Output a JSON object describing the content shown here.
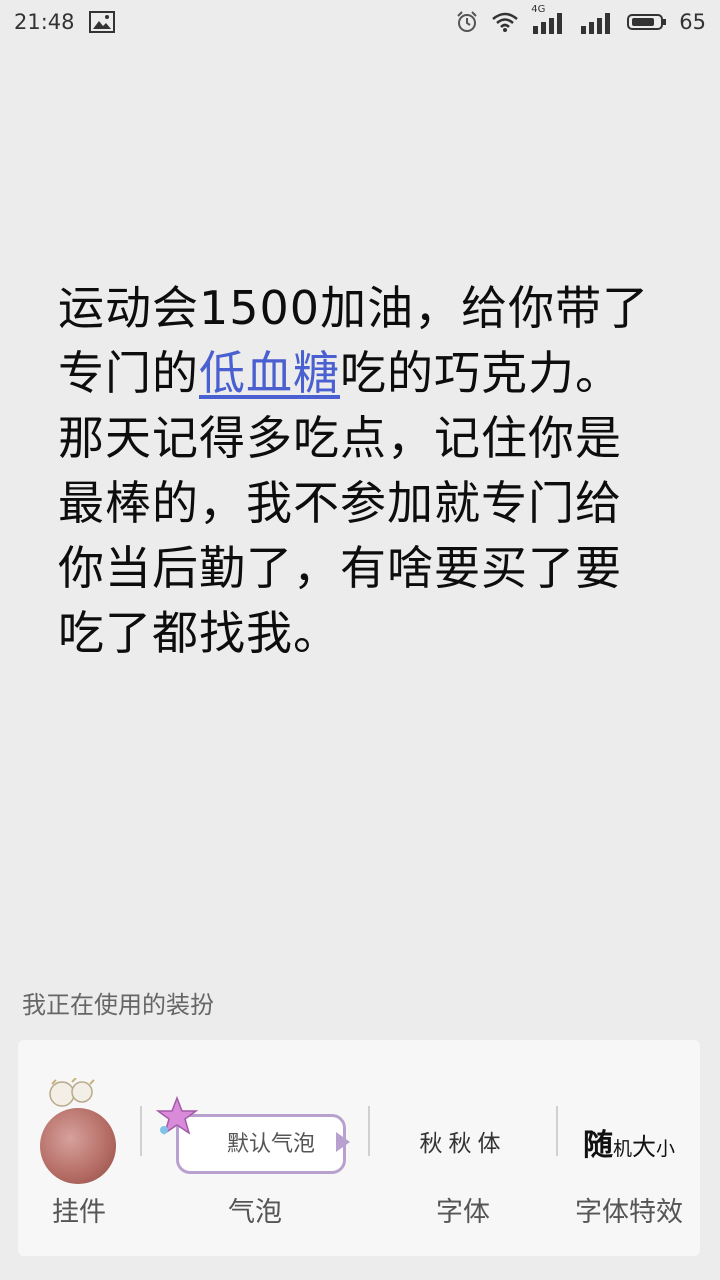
{
  "status_bar": {
    "time": "21:48",
    "network_type": "4G",
    "battery": "65",
    "icons": [
      "image-icon",
      "alarm-icon",
      "wifi-icon",
      "signal-icon",
      "battery-icon"
    ]
  },
  "message": {
    "text_before": "运动会1500加油，给你带了专门的",
    "link_text": "低血糖",
    "text_after": "吃的巧克力。那天记得多吃点，记住你是最棒的，我不参加就专门给你当后勤了，有啥要买了要吃了都找我。",
    "link_color": "#4a5fd0"
  },
  "dress_up": {
    "section_title": "我正在使用的装扮",
    "items": [
      {
        "label": "挂件"
      },
      {
        "label": "气泡",
        "preview_text": "默认气泡"
      },
      {
        "label": "字体",
        "preview_text": "秋秋体"
      },
      {
        "label": "字体特效",
        "preview": {
          "part1": "随",
          "part2": "机",
          "part3": "大",
          "part4": "小"
        }
      }
    ]
  }
}
